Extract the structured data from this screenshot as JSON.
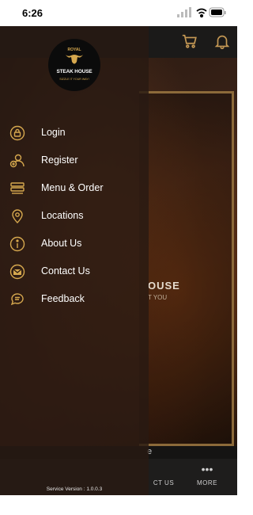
{
  "status_bar": {
    "time": "6:26"
  },
  "drawer": {
    "logo": {
      "top": "ROYAL",
      "name": "STEAK HOUSE",
      "tagline": "SIZZLE IT YOUR WAY!"
    },
    "menu": [
      {
        "label": "Login",
        "icon": "lock-icon"
      },
      {
        "label": "Register",
        "icon": "user-add-icon"
      },
      {
        "label": "Menu & Order",
        "icon": "menu-list-icon"
      },
      {
        "label": "Locations",
        "icon": "location-pin-icon"
      },
      {
        "label": "About Us",
        "icon": "info-icon"
      },
      {
        "label": "Contact Us",
        "icon": "mail-icon"
      },
      {
        "label": "Feedback",
        "icon": "chat-icon"
      }
    ],
    "version": "Service Version : 1.0.0.3"
  },
  "background": {
    "hero_title_partial": "OUSE",
    "hero_sub_partial": "T YOU",
    "strip_partial": "e",
    "tabs": [
      {
        "label": "CT US",
        "icon": "contact-icon"
      },
      {
        "label": "MORE",
        "icon": "more-dots-icon"
      }
    ]
  },
  "colors": {
    "accent": "#8c6a3a",
    "logo_gold": "#d6a84e",
    "drawer_bg": "#281a12"
  }
}
